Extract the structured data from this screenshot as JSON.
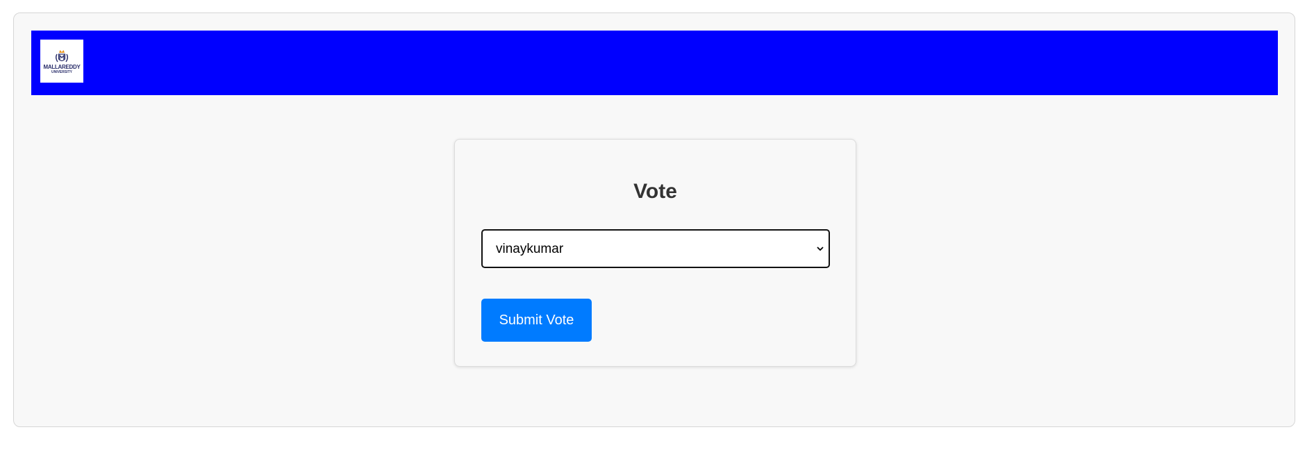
{
  "header": {
    "logo": {
      "line1": "MALLAREDDY",
      "line2": "UNIVERSITY",
      "icon": "university-crest-icon"
    },
    "background_color": "#0000ff"
  },
  "vote_form": {
    "title": "Vote",
    "candidate_select": {
      "selected": "vinaykumar"
    },
    "submit_label": "Submit Vote",
    "submit_color": "#007bff"
  }
}
